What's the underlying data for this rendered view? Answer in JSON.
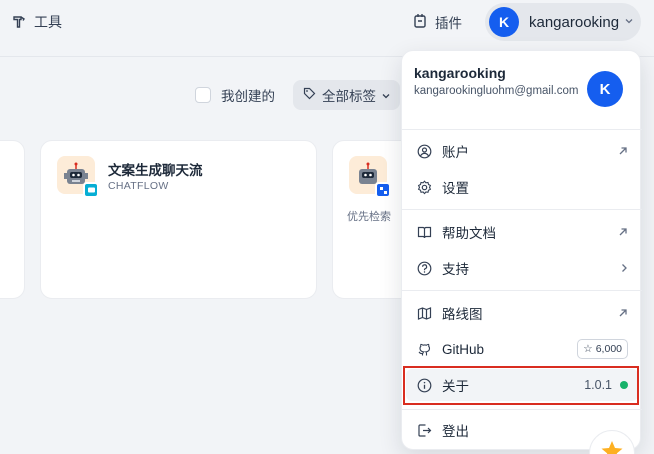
{
  "topbar": {
    "tools_label": "工具",
    "plugins_label": "插件",
    "user": {
      "avatar_letter": "K",
      "name": "kangarooking"
    }
  },
  "filters": {
    "created_by_me_label": "我创建的",
    "tags_label": "全部标签"
  },
  "cards": [
    {
      "title": "文案生成聊天流",
      "subtitle": "CHATFLOW"
    },
    {
      "description": "优先检索"
    }
  ],
  "menu": {
    "name": "kangarooking",
    "email": "kangarookingluohm@gmail.com",
    "avatar_letter": "K",
    "items": {
      "account": "账户",
      "settings": "设置",
      "help_docs": "帮助文档",
      "support": "支持",
      "roadmap": "路线图",
      "github": "GitHub",
      "github_stars": "6,000",
      "about": "关于",
      "version": "1.0.1",
      "logout": "登出"
    }
  },
  "colors": {
    "accent": "#155eef",
    "status_green": "#17b26a",
    "highlight_red": "#d92d20"
  }
}
